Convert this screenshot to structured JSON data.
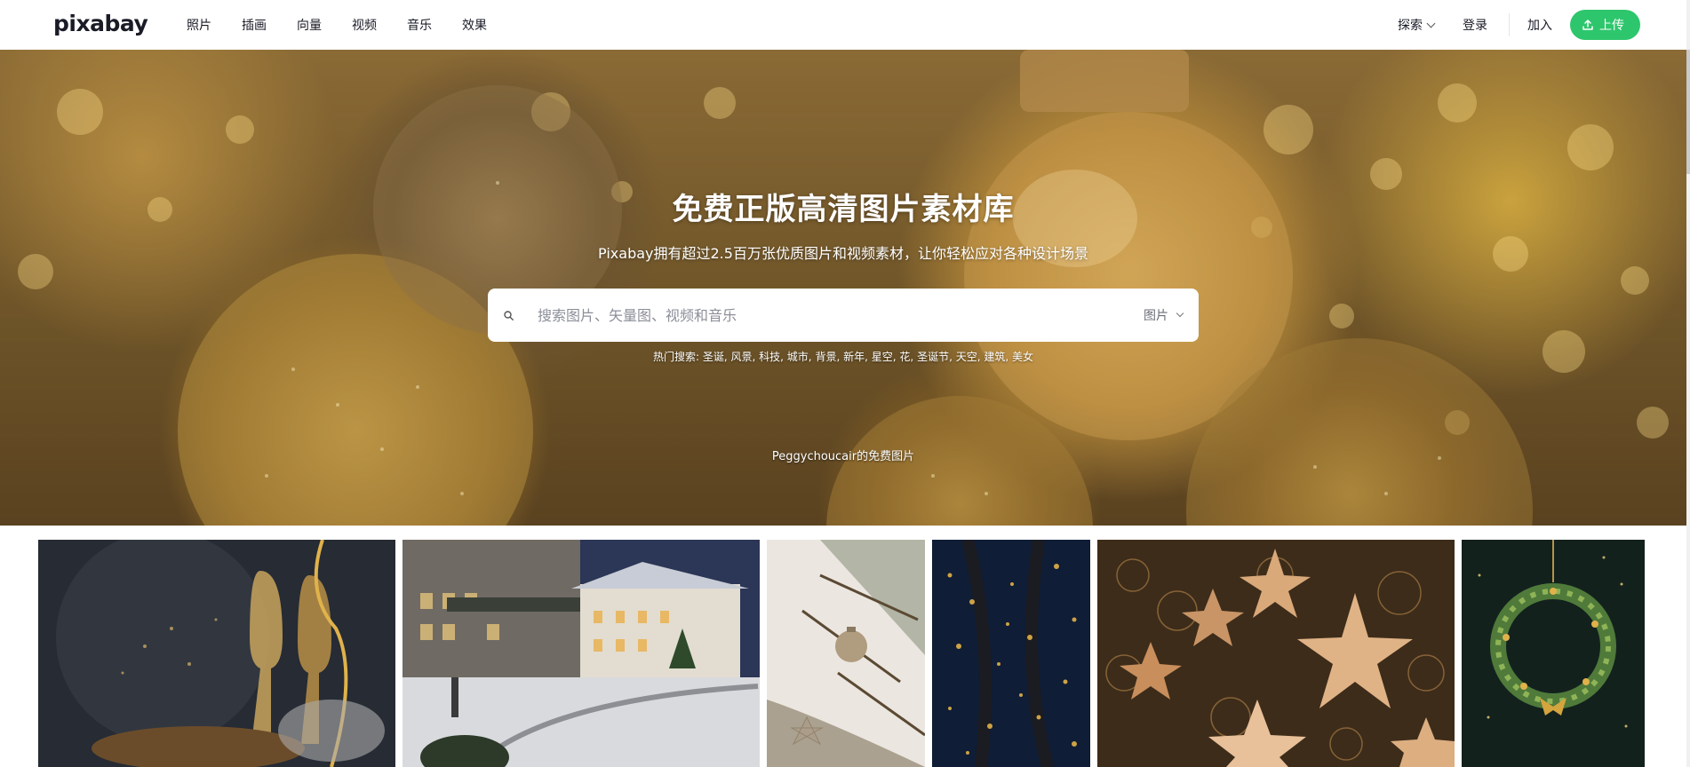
{
  "header": {
    "logo": "pixabay",
    "nav": [
      "照片",
      "插画",
      "向量",
      "视频",
      "音乐",
      "效果"
    ],
    "explore": "探索",
    "login": "登录",
    "join": "加入",
    "upload": "上传"
  },
  "hero": {
    "title": "免费正版高清图片素材库",
    "subtitle": "Pixabay拥有超过2.5百万张优质图片和视频素材，让你轻松应对各种设计场景",
    "search_placeholder": "搜索图片、矢量图、视频和音乐",
    "search_type": "图片",
    "hot_label": "热门搜索:",
    "hot_terms": [
      "圣诞",
      "风景",
      "科技",
      "城市",
      "背景",
      "新年",
      "星空",
      "花",
      "圣诞节",
      "天空",
      "建筑",
      "美女"
    ],
    "credit": "Peggychoucair的免费图片"
  },
  "gallery": [
    {
      "subject": "champagne-glasses",
      "colors": [
        "#252a33",
        "#4a4e56"
      ]
    },
    {
      "subject": "snowy-hotel-night",
      "colors": [
        "#2b3550",
        "#d8d9dc"
      ]
    },
    {
      "subject": "christmas-tree-ornament",
      "colors": [
        "#e9e3dc",
        "#5b4a33"
      ]
    },
    {
      "subject": "bokeh-lights-night",
      "colors": [
        "#0f1d35",
        "#d9a640"
      ]
    },
    {
      "subject": "golden-stars",
      "colors": [
        "#3a2a18",
        "#e3b987"
      ]
    },
    {
      "subject": "christmas-wreath",
      "colors": [
        "#12201c",
        "#6f9a45"
      ]
    }
  ],
  "colors": {
    "accent": "#2ec66d",
    "text": "#191b26"
  }
}
